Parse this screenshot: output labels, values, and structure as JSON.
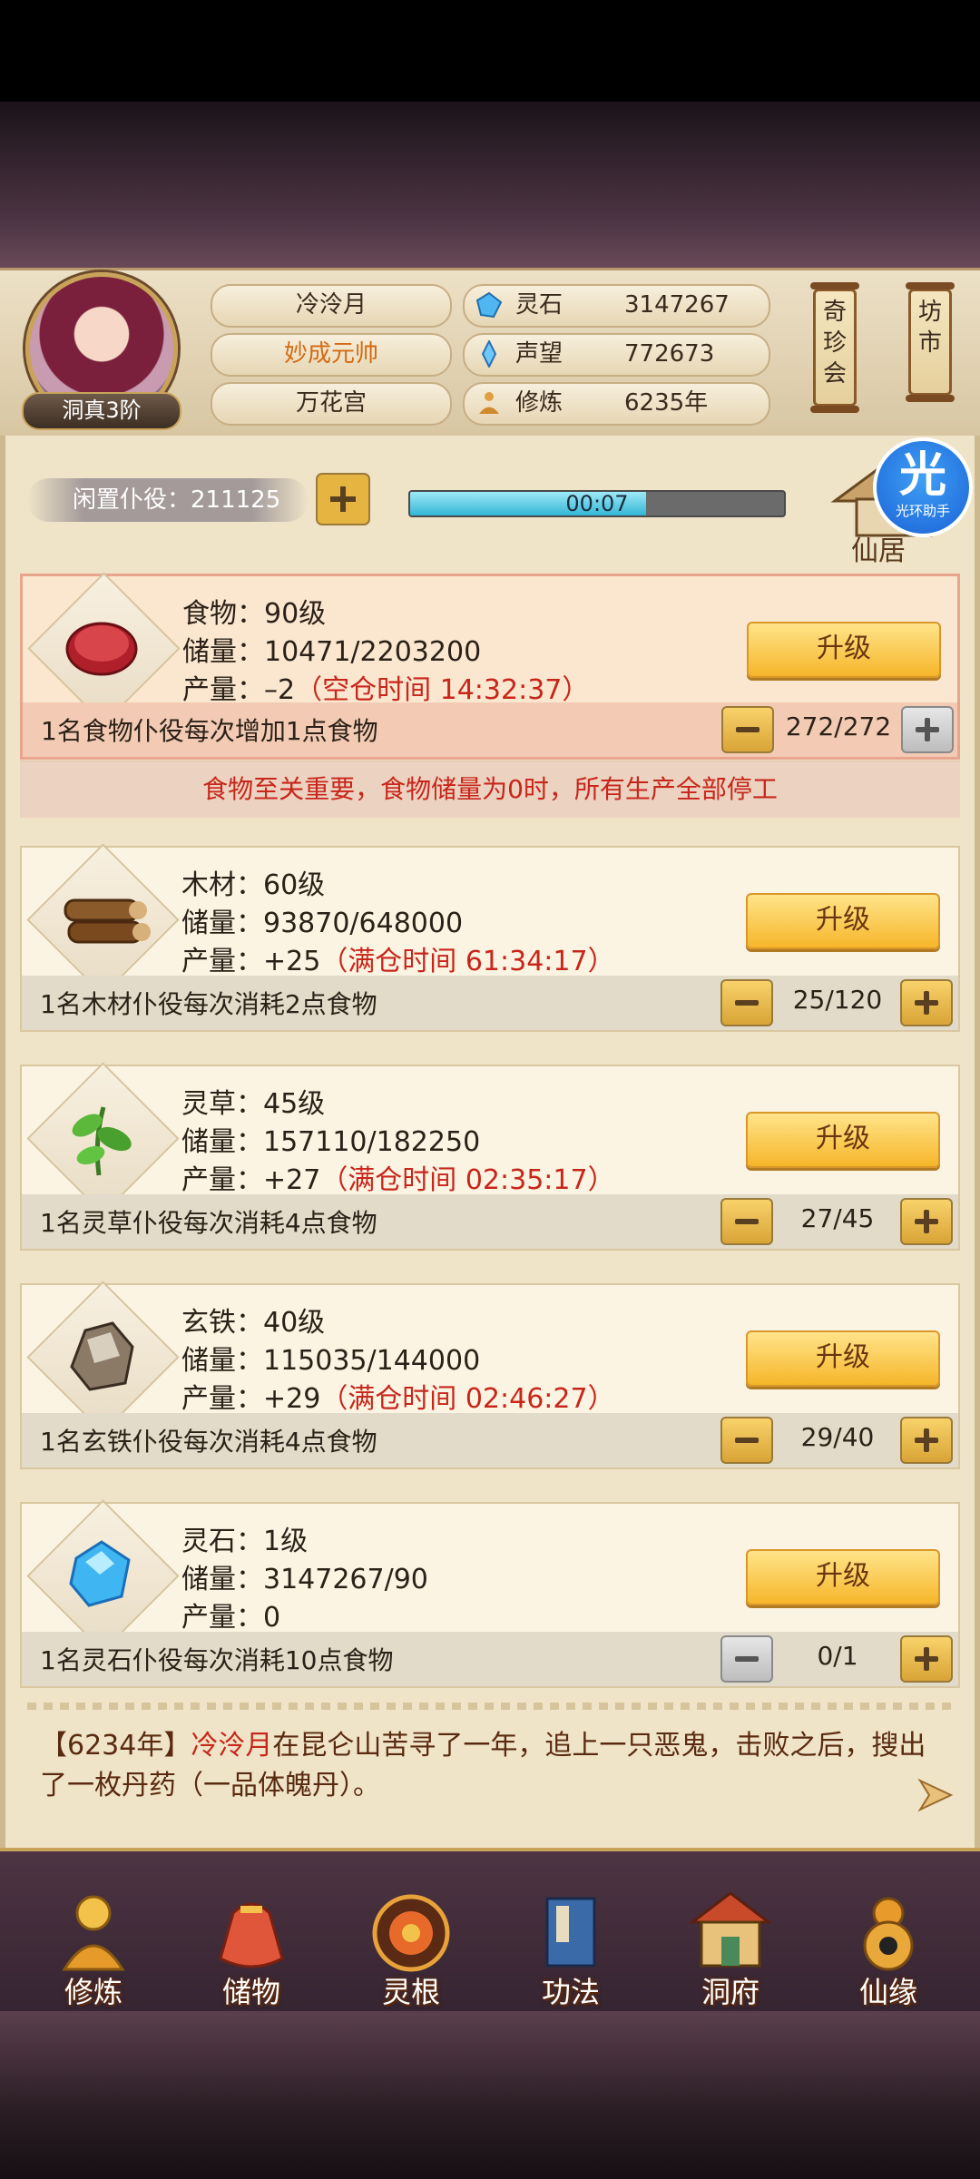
{
  "player": {
    "name": "冷泠月",
    "title": "妙成元帅",
    "sect": "万花宫",
    "rank": "洞真3阶"
  },
  "stats": [
    {
      "label": "灵石",
      "value": "3147267",
      "icon": "spirit-stone-icon"
    },
    {
      "label": "声望",
      "value": "772673",
      "icon": "prestige-icon"
    },
    {
      "label": "修炼",
      "value": "6235年",
      "icon": "cultivation-icon"
    }
  ],
  "side_buttons": {
    "treasure": "奇\n珍\n会",
    "market": "坊\n市"
  },
  "idle": {
    "label": "闲置仆役：211125"
  },
  "timer": {
    "text": "00:07",
    "progress": 0.63
  },
  "home_label": "仙居",
  "helper": {
    "big": "光",
    "small": "光环助手"
  },
  "resources": [
    {
      "name": "食物：90级",
      "storage": "储量：10471/2203200",
      "output": "产量：–2",
      "output_note": "（空仓时间 14:32:37）",
      "desc": "1名食物仆役每次增加1点食物",
      "count": "272/272",
      "upgrade": "升级",
      "icon": "meat-icon"
    },
    {
      "name": "木材：60级",
      "storage": "储量：93870/648000",
      "output": "产量：+25",
      "output_note": "（满仓时间 61:34:17）",
      "desc": "1名木材仆役每次消耗2点食物",
      "count": "25/120",
      "upgrade": "升级",
      "icon": "wood-icon"
    },
    {
      "name": "灵草：45级",
      "storage": "储量：157110/182250",
      "output": "产量：+27",
      "output_note": "（满仓时间 02:35:17）",
      "desc": "1名灵草仆役每次消耗4点食物",
      "count": "27/45",
      "upgrade": "升级",
      "icon": "herb-icon"
    },
    {
      "name": "玄铁：40级",
      "storage": "储量：115035/144000",
      "output": "产量：+29",
      "output_note": "（满仓时间 02:46:27）",
      "desc": "1名玄铁仆役每次消耗4点食物",
      "count": "29/40",
      "upgrade": "升级",
      "icon": "iron-ore-icon"
    },
    {
      "name": "灵石：1级",
      "storage": "储量：3147267/90",
      "output": "产量：0",
      "output_note": "",
      "desc": "1名灵石仆役每次消耗10点食物",
      "count": "0/1",
      "upgrade": "升级",
      "icon": "spirit-crystal-icon"
    }
  ],
  "food_warning": "食物至关重要，食物储量为0时，所有生产全部停工",
  "log": {
    "year": "【6234年】",
    "who": "冷泠月",
    "text": "在昆仑山苦寻了一年，追上一只恶鬼，击败之后，搜出了一枚丹药（一品体魄丹）。"
  },
  "nav": [
    {
      "label": "修炼",
      "icon": "cultivator-icon"
    },
    {
      "label": "储物",
      "icon": "storage-bag-icon"
    },
    {
      "label": "灵根",
      "icon": "spirit-root-icon"
    },
    {
      "label": "功法",
      "icon": "manual-book-icon"
    },
    {
      "label": "洞府",
      "icon": "cave-mansion-icon"
    },
    {
      "label": "仙缘",
      "icon": "gourd-icon"
    }
  ]
}
